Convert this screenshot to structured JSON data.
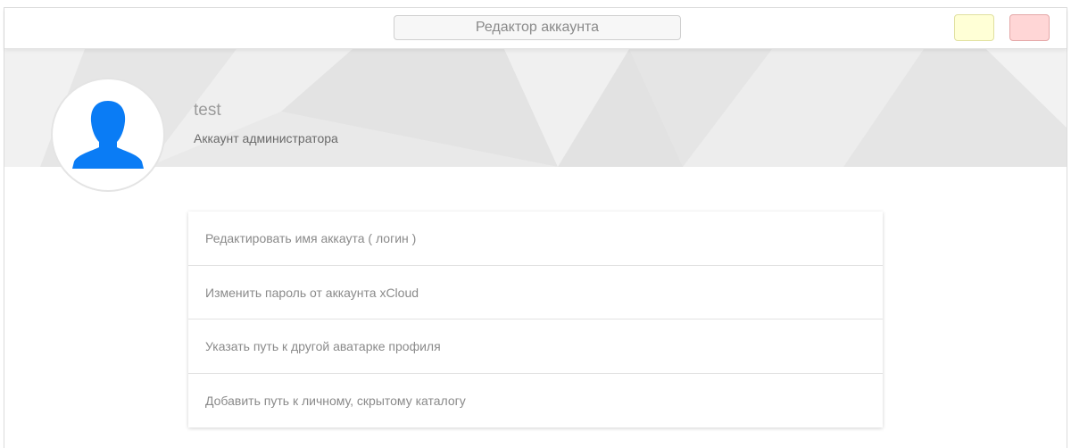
{
  "window": {
    "title": "Редактор аккаунта"
  },
  "controls": {
    "minimize_color": "#ffffd6",
    "close_color": "#ffd6d6"
  },
  "profile": {
    "username": "test",
    "role": "Аккаунт администратора",
    "avatar_icon": "user-silhouette-icon",
    "avatar_color": "#0a7cf5"
  },
  "menu": {
    "items": [
      {
        "label": "Редактировать имя аккаута ( логин )"
      },
      {
        "label": "Изменить пароль от аккаунта xCloud"
      },
      {
        "label": "Указать путь к другой аватарке профиля"
      },
      {
        "label": "Добавить путь к личному, скрытому каталогу"
      }
    ]
  }
}
